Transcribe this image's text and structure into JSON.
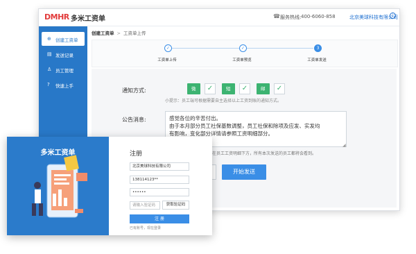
{
  "topbar": {
    "logo_text": "DMHR",
    "brand_name": "多米工资单",
    "phone_label": "服务热线:",
    "phone_number": "400-6060-858",
    "company_name": "北京美球科技有限公司"
  },
  "sidebar": {
    "items": [
      {
        "label": "创建工资单",
        "icon": "plus-circle-icon"
      },
      {
        "label": "发送记录",
        "icon": "document-icon"
      },
      {
        "label": "员工管理",
        "icon": "user-icon"
      },
      {
        "label": "快速上手",
        "icon": "question-icon"
      }
    ]
  },
  "breadcrumb": {
    "root": "创建工资单",
    "current": "工资单上传"
  },
  "steps": [
    {
      "label": "工资单上传",
      "state": "done",
      "mark": "✓"
    },
    {
      "label": "工资单预览",
      "state": "done",
      "mark": "✓"
    },
    {
      "label": "工资单发送",
      "state": "current",
      "mark": "3"
    }
  ],
  "notify": {
    "label": "通知方式:",
    "options": [
      "微信",
      "短信",
      "邮箱"
    ],
    "tip": "小提示：员工端可根据需要自主选择以上工资到账的通知方式。"
  },
  "announcement": {
    "label": "公告消息:",
    "lines": [
      "感觉各位的辛苦付出。",
      "由于本月部分员工社保基数调整，员工社保和除项及应发、实发均",
      "有影响，变化部分详情请参照工资明细部分。"
    ],
    "hint": "示在员工工资明细下方，所有本次发送的员工都将会看到。"
  },
  "actions": {
    "start_label": "开始发送"
  },
  "register": {
    "brand": "多米工资单",
    "title": "注册",
    "company_value": "北京美球科技有限公司",
    "phone_value": "138114123**",
    "password_value": "••••••",
    "code_placeholder": "请输入验证码",
    "code_button": "获取验证码",
    "submit_label": "注 册",
    "footer": "已有账号，现在登录"
  },
  "colors": {
    "primary": "#2878c8",
    "accent": "#3a8ee6",
    "check": "#3cb371",
    "logo_red": "#e23b3b"
  }
}
